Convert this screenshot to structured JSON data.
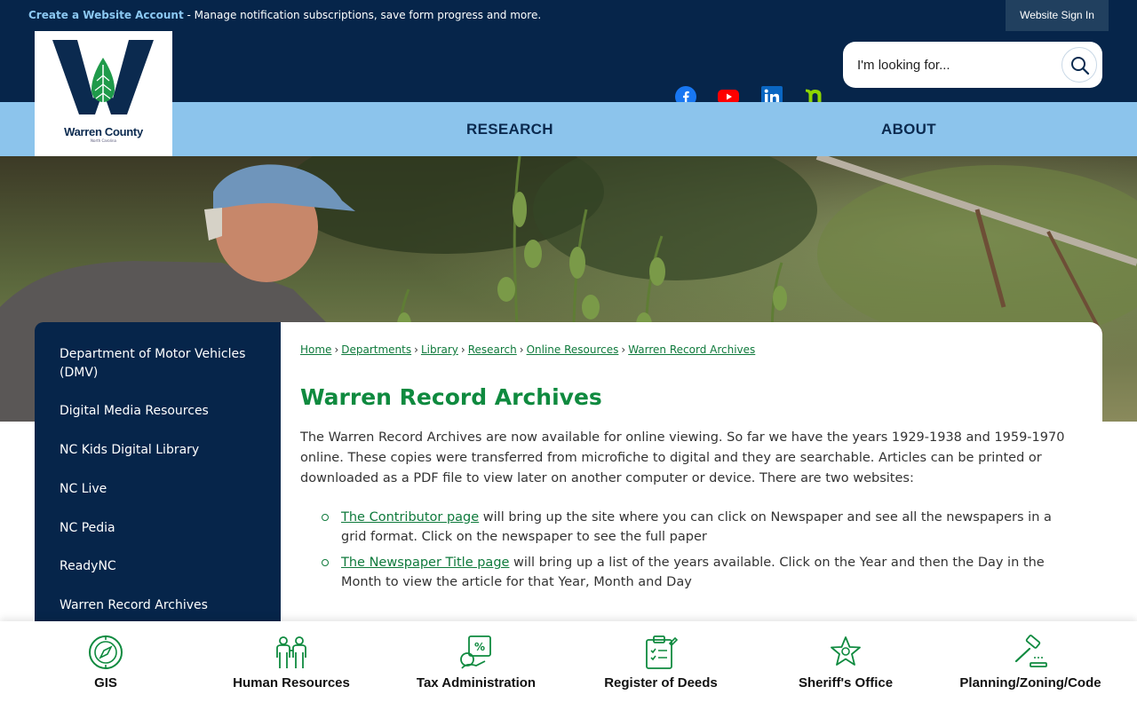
{
  "topbar": {
    "create_account_link": "Create a Website Account",
    "create_account_desc": " - Manage notification subscriptions, save form progress and more.",
    "signin_label": "Website Sign In"
  },
  "logo": {
    "name": "Warren County",
    "sub": "North Carolina"
  },
  "social": [
    "facebook-icon",
    "youtube-icon",
    "linkedin-icon",
    "nextdoor-icon"
  ],
  "search": {
    "placeholder": "I'm looking for..."
  },
  "nav": {
    "items": [
      {
        "label": "RESEARCH"
      },
      {
        "label": "ABOUT"
      }
    ]
  },
  "sidebar": {
    "items": [
      {
        "label": "Department of Motor Vehicles (DMV)"
      },
      {
        "label": "Digital Media Resources"
      },
      {
        "label": "NC Kids Digital Library"
      },
      {
        "label": "NC Live"
      },
      {
        "label": "NC Pedia"
      },
      {
        "label": "ReadyNC"
      },
      {
        "label": "Warren Record Archives"
      }
    ]
  },
  "breadcrumb": [
    "Home",
    "Departments",
    "Library",
    "Research",
    "Online Resources",
    "Warren Record Archives"
  ],
  "content": {
    "title": "Warren Record Archives",
    "intro": "The Warren Record Archives are now available for online viewing. So far we have the years 1929-1938 and 1959-1970 online. These copies were transferred from microfiche to digital and they are searchable. Articles can be printed or downloaded as a PDF file to view later on another computer or device. There are two websites:",
    "bullets": [
      {
        "link": "The Contributor page",
        "text": " will bring up the site where you can click on Newspaper and see all the newspapers in a grid format. Click on the newspaper to see the full paper"
      },
      {
        "link": "The Newspaper Title page",
        "text": " will bring up a list of the years available. Click on the Year and then the Day in the Month to view the article for that Year, Month and Day"
      }
    ]
  },
  "quick_links": [
    {
      "label": "GIS",
      "icon": "compass-icon"
    },
    {
      "label": "Human Resources",
      "icon": "people-icon"
    },
    {
      "label": "Tax Administration",
      "icon": "tax-icon"
    },
    {
      "label": "Register of Deeds",
      "icon": "clipboard-icon"
    },
    {
      "label": "Sheriff's Office",
      "icon": "badge-star-icon"
    },
    {
      "label": "Planning/Zoning/Code",
      "icon": "gavel-icon"
    }
  ],
  "colors": {
    "navy": "#06254a",
    "nav_blue": "#8cc4ec",
    "green": "#0f8a3f",
    "link_green": "#0f7a3c"
  }
}
